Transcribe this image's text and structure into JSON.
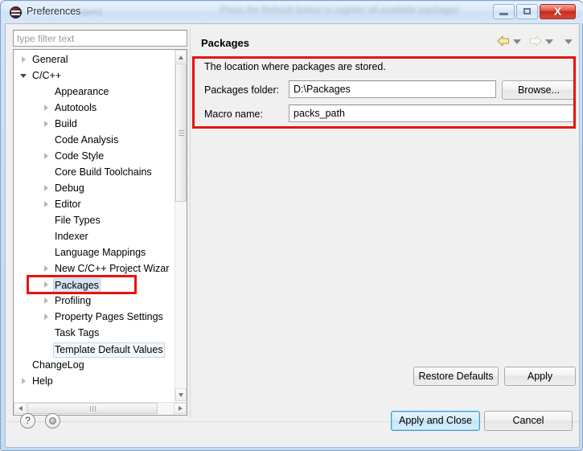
{
  "window": {
    "title": "Preferences",
    "glass_background_text": "Press the Refresh button to register all available packages",
    "glass_sub_text": "(cygwin)",
    "app_icon": "eclipse-icon",
    "controls": {
      "minimize": "minimize-icon",
      "maximize": "maximize-icon",
      "close_label": "X"
    }
  },
  "filter": {
    "placeholder": "type filter text",
    "value": ""
  },
  "tree": {
    "items": [
      {
        "label": "General",
        "indent": 0,
        "twisty": "closed",
        "state": "normal"
      },
      {
        "label": "C/C++",
        "indent": 0,
        "twisty": "open",
        "state": "normal"
      },
      {
        "label": "Appearance",
        "indent": 1,
        "twisty": "none",
        "state": "normal"
      },
      {
        "label": "Autotools",
        "indent": 1,
        "twisty": "closed",
        "state": "normal"
      },
      {
        "label": "Build",
        "indent": 1,
        "twisty": "closed",
        "state": "normal"
      },
      {
        "label": "Code Analysis",
        "indent": 1,
        "twisty": "none",
        "state": "normal"
      },
      {
        "label": "Code Style",
        "indent": 1,
        "twisty": "closed",
        "state": "normal"
      },
      {
        "label": "Core Build Toolchains",
        "indent": 1,
        "twisty": "none",
        "state": "normal"
      },
      {
        "label": "Debug",
        "indent": 1,
        "twisty": "closed",
        "state": "normal"
      },
      {
        "label": "Editor",
        "indent": 1,
        "twisty": "closed",
        "state": "normal"
      },
      {
        "label": "File Types",
        "indent": 1,
        "twisty": "none",
        "state": "normal"
      },
      {
        "label": "Indexer",
        "indent": 1,
        "twisty": "none",
        "state": "normal"
      },
      {
        "label": "Language Mappings",
        "indent": 1,
        "twisty": "none",
        "state": "normal"
      },
      {
        "label": "New C/C++ Project Wizar",
        "indent": 1,
        "twisty": "closed",
        "state": "normal"
      },
      {
        "label": "Packages",
        "indent": 1,
        "twisty": "closed",
        "state": "selected"
      },
      {
        "label": "Profiling",
        "indent": 1,
        "twisty": "closed",
        "state": "normal"
      },
      {
        "label": "Property Pages Settings",
        "indent": 1,
        "twisty": "closed",
        "state": "normal"
      },
      {
        "label": "Task Tags",
        "indent": 1,
        "twisty": "none",
        "state": "normal"
      },
      {
        "label": "Template Default Values",
        "indent": 1,
        "twisty": "none",
        "state": "hovered"
      },
      {
        "label": "ChangeLog",
        "indent": 0,
        "twisty": "none",
        "state": "normal"
      },
      {
        "label": "Help",
        "indent": 0,
        "twisty": "closed",
        "state": "normal"
      }
    ],
    "scrollbars": {
      "vertical": "tree-vertical-scrollbar",
      "horizontal": "tree-horizontal-scrollbar"
    }
  },
  "page": {
    "title": "Packages",
    "description": "The location where packages are stored.",
    "nav": {
      "back_icon": "back-arrow-icon",
      "back_menu_icon": "chevron-down-icon",
      "forward_icon": "forward-arrow-icon",
      "forward_menu_icon": "chevron-down-icon",
      "view_menu_icon": "chevron-down-icon"
    },
    "fields": [
      {
        "label": "Packages folder:",
        "value": "D:\\Packages",
        "name": "packages-folder"
      },
      {
        "label": "Macro name:",
        "value": "packs_path",
        "name": "macro-name"
      }
    ],
    "browse_label": "Browse...",
    "restore_defaults_label": "Restore Defaults",
    "apply_label": "Apply"
  },
  "footer": {
    "help_icon": "help-icon",
    "record_icon": "record-icon",
    "apply_and_close_label": "Apply and Close",
    "cancel_label": "Cancel"
  },
  "annotations": {
    "color": "#e8140c",
    "boxes": [
      {
        "name": "packages-tree-item-highlight"
      },
      {
        "name": "packages-settings-group-highlight"
      }
    ]
  }
}
